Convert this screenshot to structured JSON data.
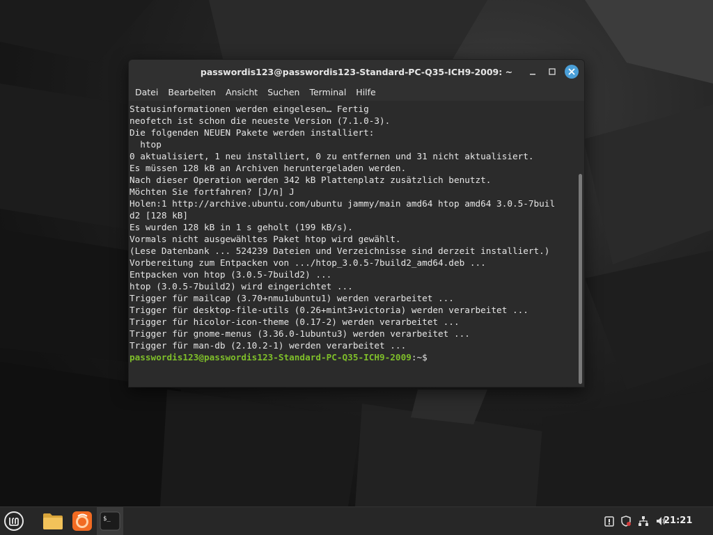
{
  "window": {
    "title": "passwordis123@passwordis123-Standard-PC-Q35-ICH9-2009: ~",
    "minimize_icon": "minimize-icon",
    "maximize_icon": "maximize-icon",
    "close_icon": "close-icon"
  },
  "menu": [
    "Datei",
    "Bearbeiten",
    "Ansicht",
    "Suchen",
    "Terminal",
    "Hilfe"
  ],
  "terminal": {
    "lines": [
      "Statusinformationen werden eingelesen… Fertig",
      "neofetch ist schon die neueste Version (7.1.0-3).",
      "Die folgenden NEUEN Pakete werden installiert:",
      "  htop",
      "0 aktualisiert, 1 neu installiert, 0 zu entfernen und 31 nicht aktualisiert.",
      "Es müssen 128 kB an Archiven heruntergeladen werden.",
      "Nach dieser Operation werden 342 kB Plattenplatz zusätzlich benutzt.",
      "Möchten Sie fortfahren? [J/n] J",
      "Holen:1 http://archive.ubuntu.com/ubuntu jammy/main amd64 htop amd64 3.0.5-7buil",
      "d2 [128 kB]",
      "Es wurden 128 kB in 1 s geholt (199 kB/s).",
      "Vormals nicht ausgewähltes Paket htop wird gewählt.",
      "(Lese Datenbank ... 524239 Dateien und Verzeichnisse sind derzeit installiert.)",
      "Vorbereitung zum Entpacken von .../htop_3.0.5-7build2_amd64.deb ...",
      "Entpacken von htop (3.0.5-7build2) ...",
      "htop (3.0.5-7build2) wird eingerichtet ...",
      "Trigger für mailcap (3.70+nmu1ubuntu1) werden verarbeitet ...",
      "Trigger für desktop-file-utils (0.26+mint3+victoria) werden verarbeitet ...",
      "Trigger für hicolor-icon-theme (0.17-2) werden verarbeitet ...",
      "Trigger für gnome-menus (3.36.0-1ubuntu3) werden verarbeitet ...",
      "Trigger für man-db (2.10.2-1) werden verarbeitet ..."
    ],
    "prompt_user": "passwordis123@passwordis123-Standard-PC-Q35-ICH9-2009",
    "prompt_path": ":~$",
    "colors": {
      "prompt": "#7fbf2a",
      "text": "#e6e6e6",
      "background": "#2b2b2b"
    }
  },
  "taskbar": {
    "launchers": [
      "mint-menu-icon",
      "files-icon",
      "firefox-icon",
      "terminal-icon"
    ],
    "tray": [
      "update-manager-icon",
      "shield-icon",
      "network-icon",
      "volume-icon"
    ],
    "clock": "21:21"
  }
}
